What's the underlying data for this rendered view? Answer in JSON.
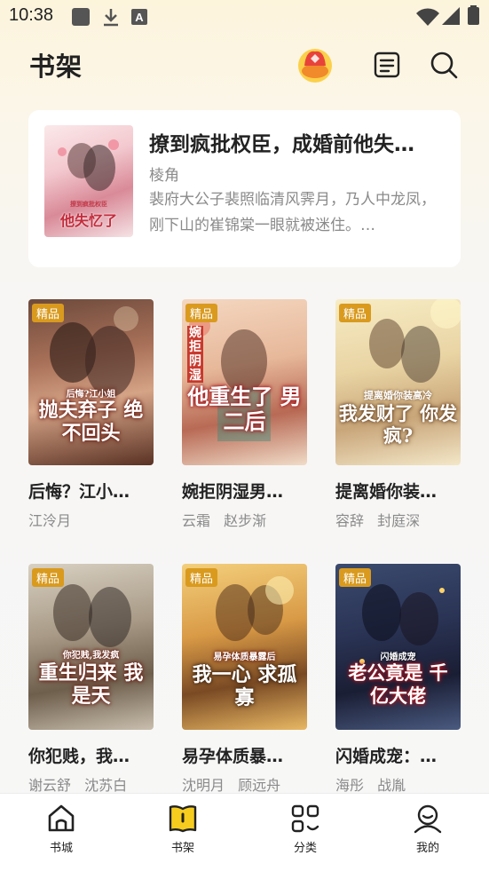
{
  "status_bar": {
    "time": "10:38",
    "icons": [
      "app-icon",
      "download-icon",
      "a-icon",
      "wifi-icon",
      "signal-icon",
      "battery-icon"
    ]
  },
  "header": {
    "title": "书架",
    "logo_icon": "fire-bowl-logo",
    "actions": [
      "notes-icon",
      "search-icon"
    ]
  },
  "recent_read": {
    "title": "撩到疯批权臣，成婚前他失…",
    "author": "棱角",
    "description": "裴府大公子裴照临清风霁月，乃人中龙凤，刚下山的崔锦棠一眼就被迷住。…",
    "cover": {
      "text_small": "撩到疯批权臣",
      "text_large": "他失忆了"
    }
  },
  "books": [
    {
      "badge": "精品",
      "title": "后悔？江小…",
      "authors": [
        "江泠月"
      ],
      "cover": {
        "text_small": "后悔?江小姐",
        "text_large": "抛夫弃子 绝不回头"
      }
    },
    {
      "badge": "精品",
      "title": "婉拒阴湿男…",
      "authors": [
        "云霜",
        "赵步渐"
      ],
      "cover": {
        "text_small": "婉拒阴湿",
        "text_large": "他重生了 男二后"
      }
    },
    {
      "badge": "精品",
      "title": "提离婚你装…",
      "authors": [
        "容辞",
        "封庭深"
      ],
      "cover": {
        "text_small": "提离婚你装高冷",
        "text_large": "我发财了 你发疯?"
      }
    },
    {
      "badge": "精品",
      "title": "你犯贱，我…",
      "authors": [
        "谢云舒",
        "沈苏白"
      ],
      "cover": {
        "text_small": "你犯贱,我发疯",
        "text_large": "重生归来 我是天"
      }
    },
    {
      "badge": "精品",
      "title": "易孕体质暴…",
      "authors": [
        "沈明月",
        "顾远舟"
      ],
      "cover": {
        "text_small": "易孕体质暴露后",
        "text_large": "我一心 求孤寡"
      }
    },
    {
      "badge": "精品",
      "title": "闪婚成宠：…",
      "authors": [
        "海彤",
        "战胤"
      ],
      "cover": {
        "text_small": "闪婚成宠",
        "text_large": "老公竟是 千亿大佬"
      }
    }
  ],
  "bottom_nav": [
    {
      "label": "书城",
      "icon": "home-icon",
      "active": false
    },
    {
      "label": "书架",
      "icon": "bookshelf-icon",
      "active": true
    },
    {
      "label": "分类",
      "icon": "category-icon",
      "active": false
    },
    {
      "label": "我的",
      "icon": "profile-icon",
      "active": false
    }
  ],
  "colors": {
    "badge": "#d99a1e",
    "active_nav": "#f6cc1e",
    "accent_red": "#e8433a"
  }
}
